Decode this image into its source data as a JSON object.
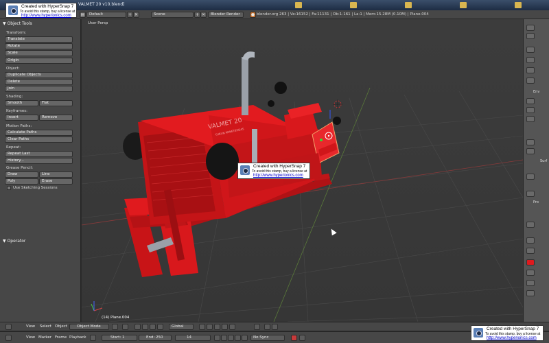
{
  "window": {
    "title": "VALMET 20 v10.blend]"
  },
  "watermark": {
    "line1": "Created with HyperSnap 7",
    "line2": "To avoid this stamp, buy a license at",
    "line3": "http://www.hyperionics.com"
  },
  "header": {
    "layout": "Default",
    "scene": "Scene",
    "engine": "Blender Render",
    "stats": "blender.org 263 | Ve:16152 | Fa:11131 | Ob:1-161 | La:1 | Mem:15.28M (0.10M) | Plane.004"
  },
  "toolshelf": {
    "title": "Object Tools",
    "transform_label": "Transform:",
    "translate": "Translate",
    "rotate": "Rotate",
    "scale": "Scale",
    "origin": "Origin",
    "object_label": "Object:",
    "duplicate": "Duplicate Objects",
    "delete": "Delete",
    "join": "Join",
    "shading_label": "Shading:",
    "smooth": "Smooth",
    "flat": "Flat",
    "keyframes_label": "Keyframes:",
    "insert": "Insert",
    "remove": "Remove",
    "motion_paths_label": "Motion Paths:",
    "calculate_paths": "Calculate Paths",
    "clear_paths": "Clear Paths",
    "repeat_label": "Repeat:",
    "repeat_last": "Repeat Last",
    "history": "History...",
    "grease_label": "Grease Pencil:",
    "draw": "Draw",
    "line": "Line",
    "poly": "Poly",
    "erase": "Erase",
    "sketching": "Use Sketching Sessions",
    "operator": "Operator"
  },
  "viewport": {
    "view_name": "User Persp",
    "object_info": "(14) Plane.004",
    "model_text": "VALMET 20",
    "model_subtext": "TURUN KONETEHDAS"
  },
  "sidecol": {
    "env": "Env",
    "surf": "Surf",
    "pro": "Pro"
  },
  "view3d_header": {
    "view": "View",
    "select": "Select",
    "object": "Object",
    "mode": "Object Mode",
    "orientation": "Global"
  },
  "timeline": {
    "view": "View",
    "marker": "Marker",
    "frame": "Frame",
    "playback": "Playback",
    "start": "Start: 1",
    "end": "End: 250",
    "current": "14",
    "sync": "No Sync"
  },
  "colors": {
    "tractor_red": "#d8181c",
    "panel_gray": "#474747",
    "viewport_bg": "#3c3c3c"
  }
}
